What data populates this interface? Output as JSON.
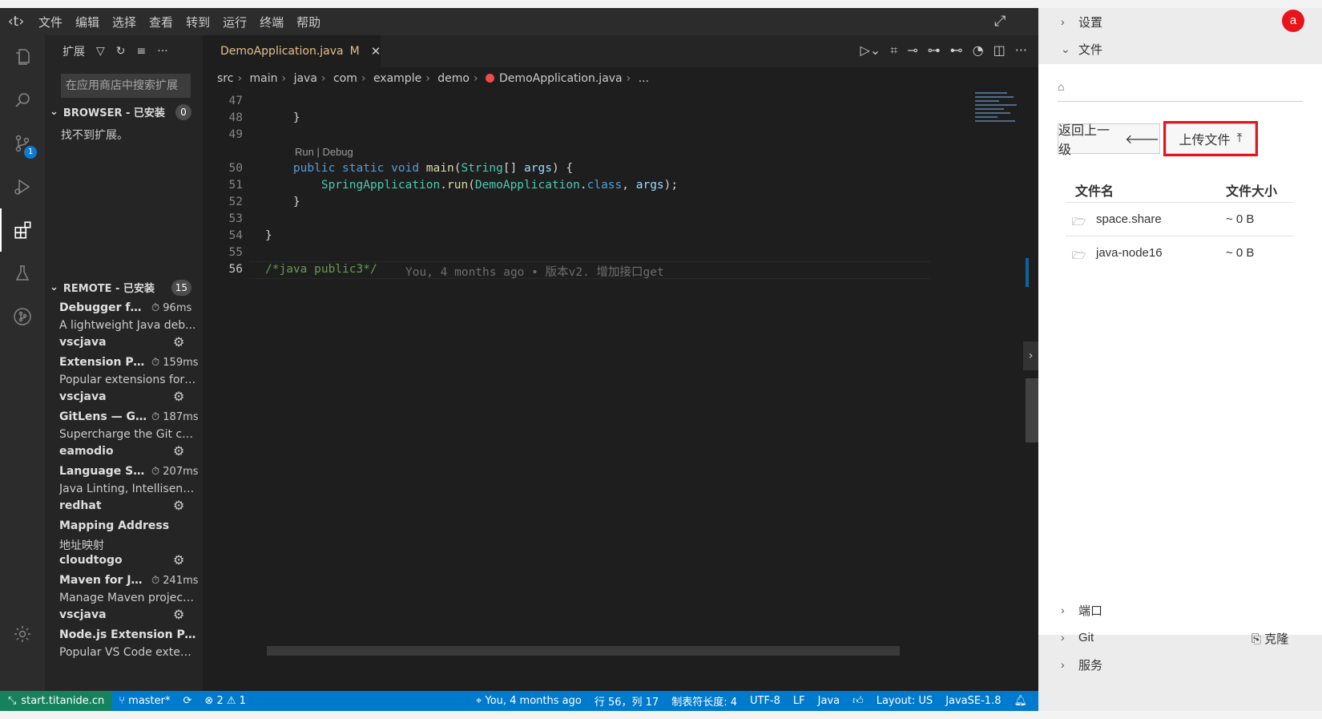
{
  "menu": {
    "items": [
      "文件",
      "编辑",
      "选择",
      "查看",
      "转到",
      "运行",
      "终端",
      "帮助"
    ]
  },
  "sidebar": {
    "title": "扩展",
    "search_placeholder": "在应用商店中搜索扩展",
    "browser_section": {
      "label": "BROWSER - 已安装",
      "count": "0",
      "empty_text": "找不到扩展。"
    },
    "remote_section": {
      "label": "REMOTE - 已安装",
      "count": "15"
    },
    "extensions": [
      {
        "name": "Debugger for ...",
        "time": "96ms",
        "desc": "A lightweight Java deb...",
        "publisher": "vscjava"
      },
      {
        "name": "Extension Pa...",
        "time": "159ms",
        "desc": "Popular extensions for ...",
        "publisher": "vscjava"
      },
      {
        "name": "GitLens — Gi...",
        "time": "187ms",
        "desc": "Supercharge the Git ca...",
        "publisher": "eamodio"
      },
      {
        "name": "Language Su...",
        "time": "207ms",
        "desc": "Java Linting, Intellisens...",
        "publisher": "redhat"
      },
      {
        "name": "Mapping Address",
        "time": "",
        "desc": "地址映射",
        "publisher": "cloudtogo"
      },
      {
        "name": "Maven for Ja...",
        "time": "241ms",
        "desc": "Manage Maven project...",
        "publisher": "vscjava"
      },
      {
        "name": "Node.js Extension Pack",
        "time": "",
        "desc": "Popular VS Code exten...",
        "publisher": ""
      }
    ]
  },
  "editor": {
    "tab": {
      "filename": "DemoApplication.java",
      "status": "M"
    },
    "breadcrumb": [
      "src",
      "main",
      "java",
      "com",
      "example",
      "demo",
      "DemoApplication.java",
      "..."
    ],
    "codelens": "Run | Debug",
    "lines": [
      {
        "num": "47",
        "text": ""
      },
      {
        "num": "48",
        "text": "    }"
      },
      {
        "num": "49",
        "text": ""
      },
      {
        "num": "50",
        "text": "    public static void main(String[] args) {"
      },
      {
        "num": "51",
        "text": "        SpringApplication.run(DemoApplication.class, args);"
      },
      {
        "num": "52",
        "text": "    }"
      },
      {
        "num": "53",
        "text": ""
      },
      {
        "num": "54",
        "text": "}"
      },
      {
        "num": "55",
        "text": ""
      },
      {
        "num": "56",
        "text": "/*java public3*/"
      }
    ],
    "blame": "You, 4 months ago • 版本v2. 增加接口get"
  },
  "status": {
    "remote": "start.titanide.cn",
    "branch": "master*",
    "errors": "2",
    "warnings": "1",
    "blame": "You, 4 months ago",
    "position": "行 56，列 17",
    "indent": "制表符长度: 4",
    "encoding": "UTF-8",
    "eol": "LF",
    "language": "Java",
    "layout": "Layout: US",
    "jdk": "JavaSE-1.8"
  },
  "right_panel": {
    "settings_label": "设置",
    "files_label": "文件",
    "back_button": "返回上一级",
    "upload_button": "上传文件",
    "col_name": "文件名",
    "col_size": "文件大小",
    "files": [
      {
        "name": "space.share",
        "size": "~ 0 B"
      },
      {
        "name": "java-node16",
        "size": "~ 0 B"
      }
    ],
    "ports_label": "端口",
    "git_label": "Git",
    "clone_label": "克隆",
    "services_label": "服务",
    "avatar_letter": "a"
  },
  "colors": {
    "status_bar": "#007acc",
    "remote_indicator": "#16825d",
    "highlight_outline": "#e8131b",
    "avatar": "#e8131b"
  }
}
